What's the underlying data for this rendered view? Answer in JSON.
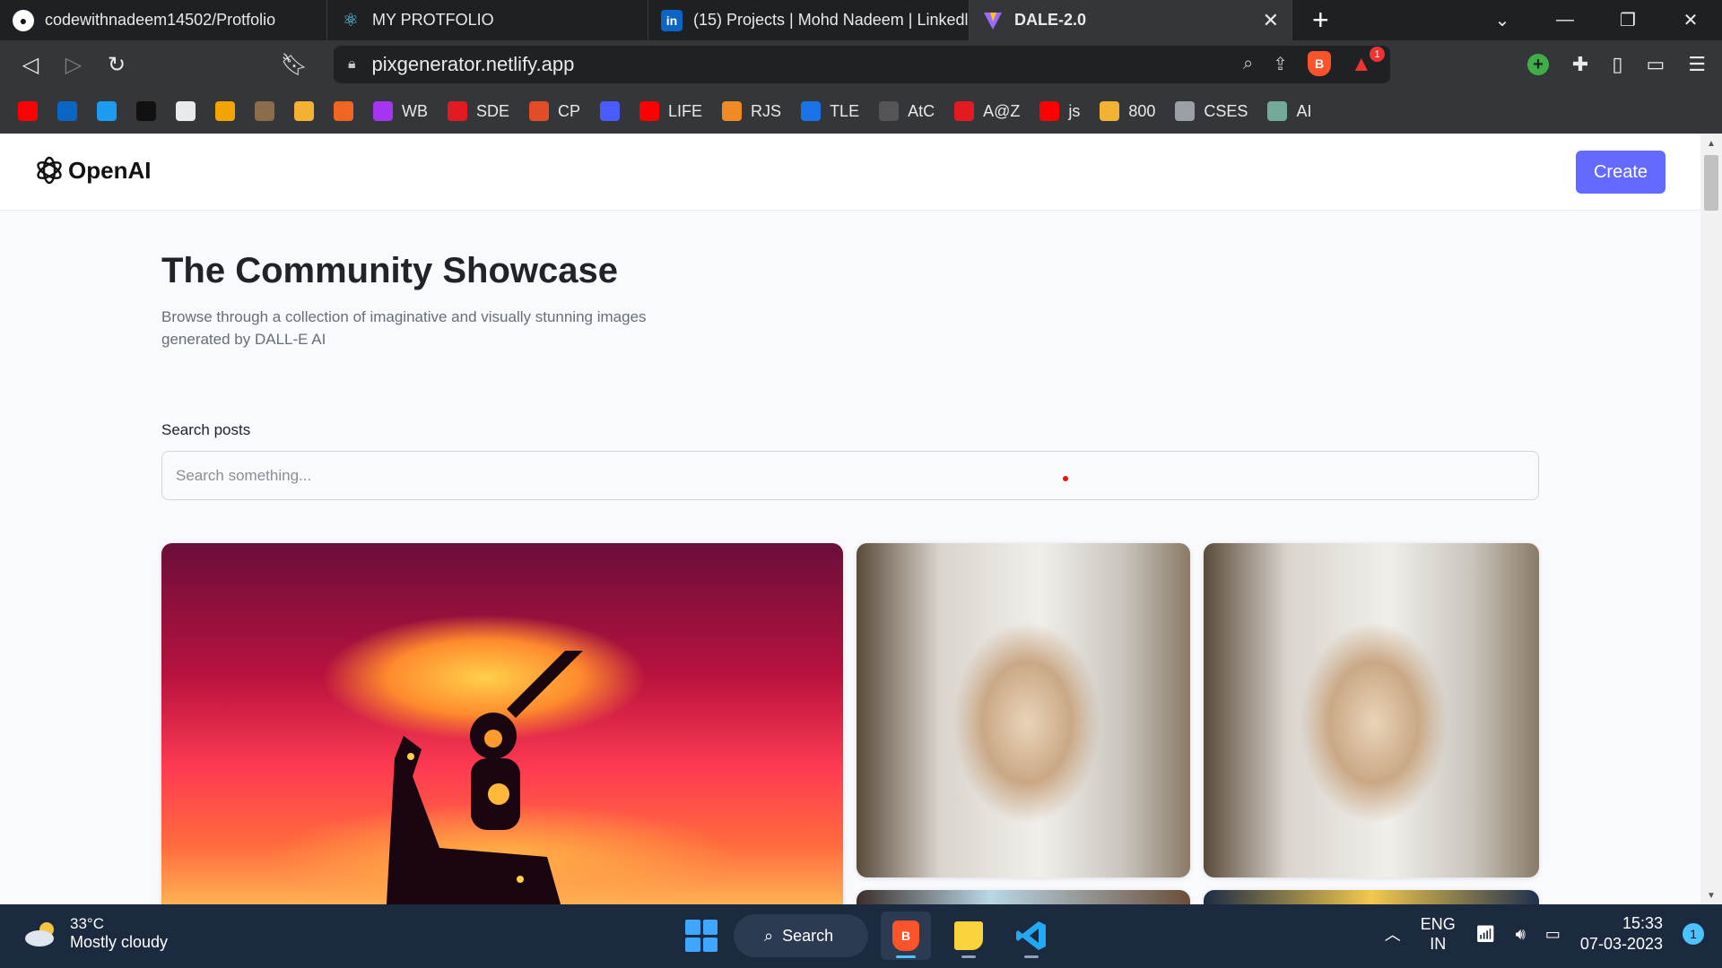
{
  "browser": {
    "tabs": [
      {
        "title": "codewithnadeem14502/Protfolio",
        "icon": "github-icon"
      },
      {
        "title": "MY PROTFOLIO",
        "icon": "react-icon"
      },
      {
        "title": "(15) Projects | Mohd Nadeem | Linkedl",
        "icon": "linkedin-icon"
      },
      {
        "title": "DALE-2.0",
        "icon": "vite-icon",
        "active": true
      }
    ],
    "address": "pixgenerator.netlify.app",
    "shields_count": "1",
    "bookmarks": [
      {
        "label": "",
        "icon": "youtube-icon",
        "color": "#ff0000"
      },
      {
        "label": "",
        "icon": "linkedin-icon",
        "color": "#0a66c2"
      },
      {
        "label": "",
        "icon": "twitter-icon",
        "color": "#1d9bf0"
      },
      {
        "label": "",
        "icon": "hackerrank-icon",
        "color": "#111111"
      },
      {
        "label": "",
        "icon": "github-icon",
        "color": "#e8eaed"
      },
      {
        "label": "",
        "icon": "leetcode-icon",
        "color": "#f0a500"
      },
      {
        "label": "",
        "icon": "codechef-icon",
        "color": "#8a6d4b"
      },
      {
        "label": "",
        "icon": "bar-chart-icon",
        "color": "#f2b233"
      },
      {
        "label": "",
        "icon": "codingninjas-icon",
        "color": "#f26522"
      },
      {
        "label": "WB",
        "icon": "udemy-icon",
        "color": "#a435f0"
      },
      {
        "label": "SDE",
        "icon": "tuf-icon",
        "color": "#e21b23"
      },
      {
        "label": "CP",
        "icon": "chart-icon",
        "color": "#e34c26"
      },
      {
        "label": "",
        "icon": "calendar-icon",
        "color": "#4a5cff"
      },
      {
        "label": "LIFE",
        "icon": "youtube-icon",
        "color": "#ff0000"
      },
      {
        "label": "RJS",
        "icon": "codeforces-icon",
        "color": "#f08a24"
      },
      {
        "label": "TLE",
        "icon": "tle-icon",
        "color": "#1a73e8"
      },
      {
        "label": "AtC",
        "icon": "atcoder-icon",
        "color": "#555555"
      },
      {
        "label": "A@Z",
        "icon": "tuf-icon",
        "color": "#e21b23"
      },
      {
        "label": "js",
        "icon": "youtube-icon",
        "color": "#ff0000"
      },
      {
        "label": "800",
        "icon": "bar-chart-icon",
        "color": "#f2b233"
      },
      {
        "label": "CSES",
        "icon": "globe-icon",
        "color": "#9aa0a6"
      },
      {
        "label": "AI",
        "icon": "openai-icon",
        "color": "#74aa9c"
      }
    ]
  },
  "app": {
    "logo_text": "OpenAI",
    "create_label": "Create",
    "title": "The Community Showcase",
    "subtitle": "Browse through a collection of imaginative and visually stunning images generated by DALL-E AI",
    "search_label": "Search posts",
    "search_placeholder": "Search something...",
    "search_value": ""
  },
  "taskbar": {
    "temperature": "33°C",
    "weather": "Mostly cloudy",
    "search_label": "Search",
    "lang_top": "ENG",
    "lang_bottom": "IN",
    "time": "15:33",
    "date": "07-03-2023",
    "notifications": "1"
  }
}
